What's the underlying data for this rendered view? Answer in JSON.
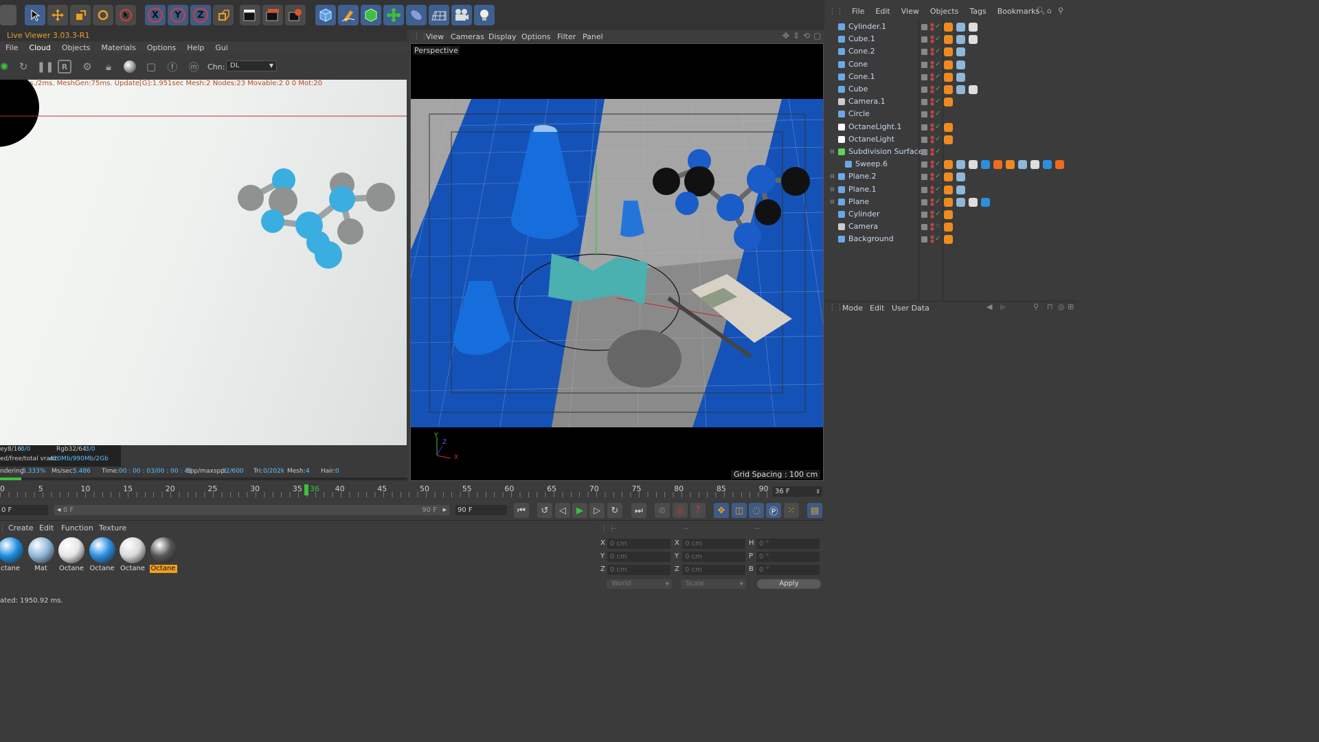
{
  "toolbar": {
    "icons": [
      "model-mode-icon",
      "move-icon",
      "scale-icon",
      "rotate-icon",
      "select-icon",
      "x-axis-icon",
      "y-axis-icon",
      "z-axis-icon",
      "coord-system-icon",
      "render-view-icon",
      "render-picture-icon",
      "render-settings-icon",
      "cube-icon",
      "pen-icon",
      "subdivision-icon",
      "array-icon",
      "deformer-icon",
      "floor-icon",
      "camera-icon",
      "light-icon"
    ],
    "axis_labels": [
      "X",
      "Y",
      "Z"
    ]
  },
  "live_viewer": {
    "title": "Live Viewer 3.03.3-R1",
    "menu": [
      "File",
      "Cloud",
      "Objects",
      "Materials",
      "Options",
      "Help",
      "Gui"
    ],
    "channel_label": "Chn:",
    "channel_value": "DL",
    "status_line": "heck:1ms./2ms. MeshGen:75ms. Update[G]:1.951sec Mesh:2 Nodes:23 Movable:2  0 0 Mot:20",
    "stats": {
      "key8": "ey8/16:",
      "key8_val": "0/0",
      "rgb": "Rgb32/64:",
      "rgb_val": "3/0",
      "vram": "ed/free/total vram:",
      "vram_val": "420Mb/990Mb/2Gb",
      "rendering": "ndering:",
      "rendering_val": "5.333%",
      "mssec": "Ms/sec:",
      "mssec_val": "5.486",
      "time": "Time:",
      "time_val": "00 : 00 : 03/00 : 00 : 45",
      "spp": "Spp/maxspp:",
      "spp_val": "32/600",
      "tri": "Tri:",
      "tri_val": "0/202k",
      "mesh": "Mesh:",
      "mesh_val": "4",
      "hair": "Hair:",
      "hair_val": "0"
    },
    "progress_fraction": 0.053
  },
  "viewport": {
    "menu": [
      "View",
      "Cameras",
      "Display",
      "Options",
      "Filter",
      "Panel"
    ],
    "label": "Perspective",
    "grid_spacing": "Grid Spacing : 100 cm",
    "axis_x": "X",
    "axis_y": "Y",
    "axis_z": "Z"
  },
  "object_manager": {
    "menu": [
      "File",
      "Edit",
      "View",
      "Objects",
      "Tags",
      "Bookmarks"
    ],
    "objects": [
      {
        "name": "Cylinder.1",
        "icon": "cylinder-icon",
        "color": "#6aa8e8"
      },
      {
        "name": "Cube.1",
        "icon": "cube-icon",
        "color": "#6aa8e8"
      },
      {
        "name": "Cone.2",
        "icon": "cone-icon",
        "color": "#6aa8e8"
      },
      {
        "name": "Cone",
        "icon": "cone-icon",
        "color": "#6aa8e8"
      },
      {
        "name": "Cone.1",
        "icon": "cone-icon",
        "color": "#6aa8e8"
      },
      {
        "name": "Cube",
        "icon": "cube-icon",
        "color": "#6aa8e8"
      },
      {
        "name": "Camera.1",
        "icon": "camera-icon",
        "color": "#cccccc"
      },
      {
        "name": "Circle",
        "icon": "circle-icon",
        "color": "#6aa8e8"
      },
      {
        "name": "OctaneLight.1",
        "icon": "light-icon",
        "color": "#ffffff"
      },
      {
        "name": "OctaneLight",
        "icon": "light-icon",
        "color": "#ffffff"
      },
      {
        "name": "Subdivision Surface",
        "icon": "subdivision-icon",
        "color": "#5fd35f"
      },
      {
        "name": "Sweep.6",
        "icon": "sweep-icon",
        "color": "#6aa8e8"
      },
      {
        "name": "Plane.2",
        "icon": "plane-icon",
        "color": "#6aa8e8"
      },
      {
        "name": "Plane.1",
        "icon": "plane-icon",
        "color": "#6aa8e8"
      },
      {
        "name": "Plane",
        "icon": "plane-icon",
        "color": "#6aa8e8"
      },
      {
        "name": "Cylinder",
        "icon": "cylinder-icon",
        "color": "#6aa8e8"
      },
      {
        "name": "Camera",
        "icon": "camera-icon",
        "color": "#cccccc"
      },
      {
        "name": "Background",
        "icon": "background-icon",
        "color": "#6aa8e8"
      }
    ]
  },
  "attributes": {
    "menu": [
      "Mode",
      "Edit",
      "User Data"
    ]
  },
  "timeline": {
    "ticks": [
      "0",
      "5",
      "10",
      "15",
      "20",
      "25",
      "30",
      "35",
      "40",
      "45",
      "50",
      "55",
      "60",
      "65",
      "70",
      "75",
      "80",
      "85",
      "90"
    ],
    "current_frame": "36",
    "current_frame_field": "36 F"
  },
  "transport": {
    "start_field": "0 F",
    "range_start": "0 F",
    "range_end": "90 F",
    "end_field": "90 F"
  },
  "material_manager": {
    "menu": [
      "Create",
      "Edit",
      "Function",
      "Texture"
    ],
    "materials": [
      {
        "label": "ctane",
        "color": "#1d8fe0"
      },
      {
        "label": "Mat",
        "color": "#8fb7d8"
      },
      {
        "label": "Octane",
        "color": "#e6e6e6"
      },
      {
        "label": "Octane",
        "color": "#2b8fe0"
      },
      {
        "label": "Octane",
        "color": "#d9d9d9"
      },
      {
        "label": "Octane",
        "color": "#555555"
      }
    ]
  },
  "coordinates": {
    "headers": [
      "--",
      "--",
      "--"
    ],
    "rows": [
      {
        "a": "X",
        "av": "0 cm",
        "b": "X",
        "bv": "0 cm",
        "c": "H",
        "cv": "0 °"
      },
      {
        "a": "Y",
        "av": "0 cm",
        "b": "Y",
        "bv": "0 cm",
        "c": "P",
        "cv": "0 °"
      },
      {
        "a": "Z",
        "av": "0 cm",
        "b": "Z",
        "bv": "0 cm",
        "c": "B",
        "cv": "0 °"
      }
    ],
    "space": "World",
    "mode": "Scale",
    "apply": "Apply"
  },
  "status_bar": "ated: 1950.92 ms."
}
